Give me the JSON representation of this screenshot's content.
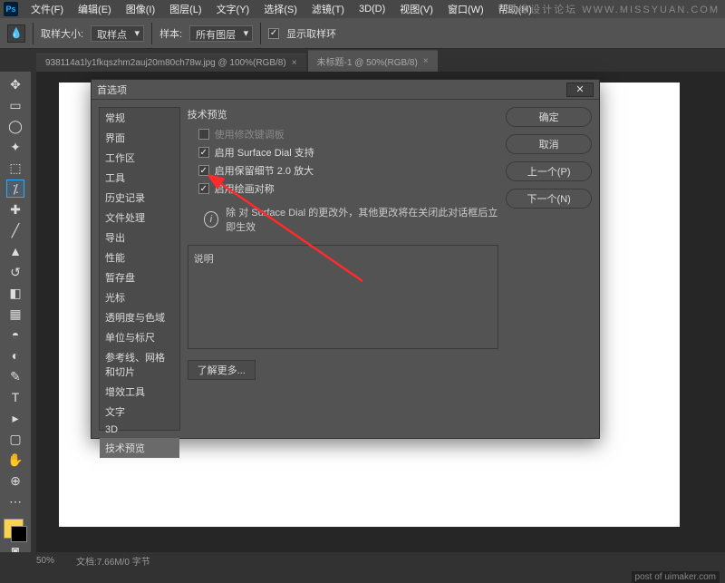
{
  "menubar": {
    "ps": "Ps",
    "items": [
      "文件(F)",
      "编辑(E)",
      "图像(I)",
      "图层(L)",
      "文字(Y)",
      "选择(S)",
      "滤镜(T)",
      "3D(D)",
      "视图(V)",
      "窗口(W)",
      "帮助(H)"
    ]
  },
  "optionsbar": {
    "sampleSizeLabel": "取样大小:",
    "sampleSizeValue": "取样点",
    "sampleLabel": "样本:",
    "sampleValue": "所有图层",
    "showRingLabel": "显示取样环"
  },
  "tabs": [
    {
      "label": "938114a1ly1fkqszhm2auj20m80ch78w.jpg @ 100%(RGB/8)"
    },
    {
      "label": "未标题-1 @ 50%(RGB/8)"
    }
  ],
  "toolbar": {
    "tools": [
      "↕",
      "▭",
      "◌",
      "✎",
      "⟋",
      "✂",
      "✎",
      "⌕",
      "◔",
      "◒",
      "⎚",
      "▭",
      "◢",
      "✎",
      "T",
      "▹",
      "⬠",
      "✋",
      "⊕",
      "⋯"
    ]
  },
  "dialog": {
    "title": "首选项",
    "categories": [
      "常规",
      "界面",
      "工作区",
      "工具",
      "历史记录",
      "文件处理",
      "导出",
      "性能",
      "暂存盘",
      "光标",
      "透明度与色域",
      "单位与标尺",
      "参考线、网格和切片",
      "增效工具",
      "文字",
      "3D",
      "技术预览"
    ],
    "sectionTitle": "技术预览",
    "rows": {
      "useModKeys": "使用修改键调板",
      "enableSurfaceDial": "启用 Surface Dial 支持",
      "enableDetails": "启用保留细节 2.0 放大",
      "enableSymmetry": "启用绘画对称"
    },
    "infoText": "除 对 Surface Dial 的更改外，其他更改将在关闭此对话框后立即生效",
    "descTitle": "说明",
    "moreBtn": "了解更多...",
    "buttons": {
      "ok": "确定",
      "cancel": "取消",
      "prev": "上一个(P)",
      "next": "下一个(N)"
    }
  },
  "statusbar": {
    "zoom": "50%",
    "docinfo": "文档:7.66M/0 字节"
  },
  "watermarks": {
    "tr": "思缘设计论坛  WWW.MISSYUAN.COM",
    "br": "post of uimaker.com"
  }
}
